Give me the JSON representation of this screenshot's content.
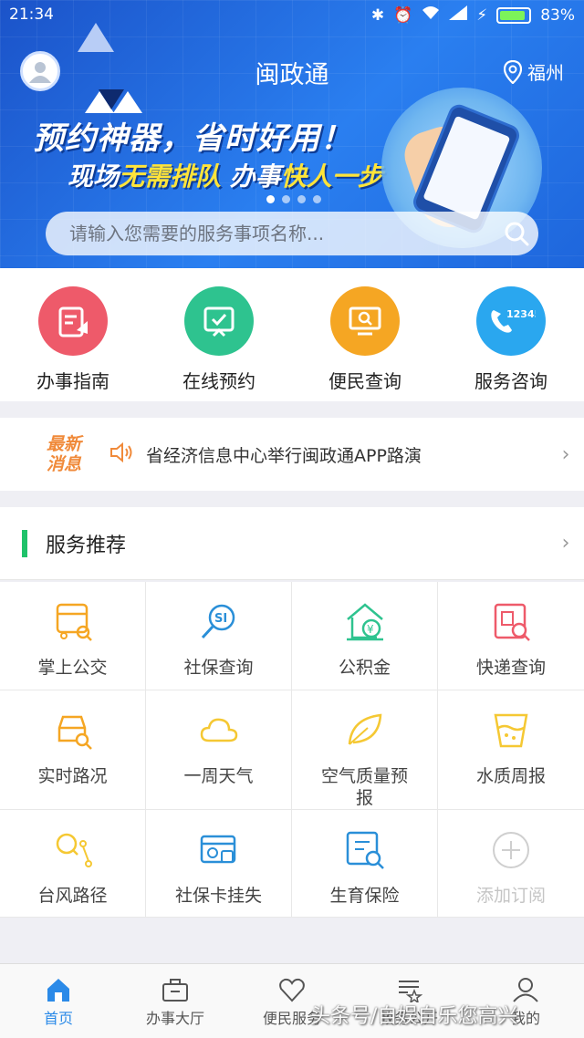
{
  "status_bar": {
    "time": "21:34",
    "battery": "83%"
  },
  "header": {
    "title": "闽政通",
    "location": "福州",
    "slogan_line1": "预约神器，省时好用！",
    "slogan_line2_a": "现场",
    "slogan_line2_b": "无需排队",
    "slogan_line2_c": " 办事",
    "slogan_line2_d": "快人一步"
  },
  "search": {
    "placeholder": "请输入您需要的服务事项名称..."
  },
  "quick_services": [
    {
      "label": "办事指南",
      "color": "#ee5a6a"
    },
    {
      "label": "在线预约",
      "color": "#2ec38f"
    },
    {
      "label": "便民查询",
      "color": "#f5a623"
    },
    {
      "label": "服务咨询",
      "color": "#2aa7ef",
      "badge": "12345"
    }
  ],
  "news": {
    "tag": "最新消息",
    "tag_line1": "最新",
    "tag_line2": "消息",
    "text": "省经济信息中心举行闽政通APP路演"
  },
  "recommend": {
    "title": "服务推荐",
    "items": [
      {
        "label": "掌上公交",
        "icon": "bus-icon"
      },
      {
        "label": "社保查询",
        "icon": "social-security-search-icon"
      },
      {
        "label": "公积金",
        "icon": "housing-fund-icon"
      },
      {
        "label": "快递查询",
        "icon": "express-search-icon"
      },
      {
        "label": "实时路况",
        "icon": "traffic-icon"
      },
      {
        "label": "一周天气",
        "icon": "cloud-icon"
      },
      {
        "label": "空气质量预报",
        "icon": "leaf-icon"
      },
      {
        "label": "水质周报",
        "icon": "water-cup-icon"
      },
      {
        "label": "台风路径",
        "icon": "typhoon-path-icon"
      },
      {
        "label": "社保卡挂失",
        "icon": "social-card-icon"
      },
      {
        "label": "生育保险",
        "icon": "maternity-insurance-icon"
      },
      {
        "label": "添加订阅",
        "icon": "add-icon"
      }
    ]
  },
  "tabs": [
    {
      "label": "首页",
      "active": true
    },
    {
      "label": "办事大厅"
    },
    {
      "label": "便民服务"
    },
    {
      "label": "政务公开"
    },
    {
      "label": "我的"
    }
  ],
  "watermark": "头条号/自娱自乐您高兴",
  "colors": {
    "accent": "#2b8ae8",
    "green_bar": "#1fc26a",
    "icon_orange": "#f5a623"
  }
}
